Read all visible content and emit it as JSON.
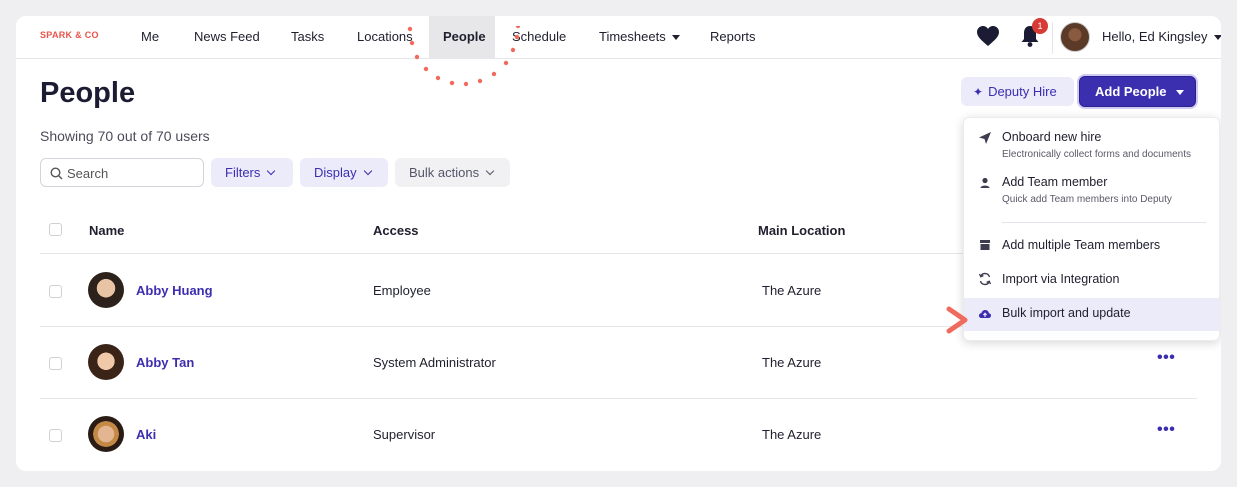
{
  "nav": {
    "brand": "SPARK & CO",
    "items": [
      {
        "label": "Me"
      },
      {
        "label": "News Feed"
      },
      {
        "label": "Tasks"
      },
      {
        "label": "Locations"
      },
      {
        "label": "People"
      },
      {
        "label": "Schedule"
      },
      {
        "label": "Timesheets"
      },
      {
        "label": "Reports"
      }
    ],
    "active": "People",
    "notification_count": "1",
    "greeting": "Hello, Ed Kingsley",
    "icons": [
      "heart-icon",
      "bell-icon",
      "user-avatar"
    ]
  },
  "header": {
    "title": "People",
    "showing": "Showing 70 out of 70 users",
    "deputy_hire_label": "Deputy Hire",
    "add_people_label": "Add People"
  },
  "toolbar": {
    "search_placeholder": "Search",
    "filters_label": "Filters",
    "display_label": "Display",
    "bulk_actions_label": "Bulk actions"
  },
  "table": {
    "columns": [
      "Name",
      "Access",
      "Main Location"
    ],
    "rows": [
      {
        "name": "Abby Huang",
        "access": "Employee",
        "location": "The Azure"
      },
      {
        "name": "Abby Tan",
        "access": "System Administrator",
        "location": "The Azure"
      },
      {
        "name": "Aki",
        "access": "Supervisor",
        "location": "The Azure"
      }
    ],
    "more_label": "•••"
  },
  "menu": {
    "items": [
      {
        "title": "Onboard new hire",
        "subtitle": "Electronically collect forms and documents",
        "icon": "paper-plane-icon"
      },
      {
        "title": "Add Team member",
        "subtitle": "Quick add Team members into Deputy",
        "icon": "person-icon"
      },
      {
        "title": "Add multiple Team members",
        "icon": "store-icon"
      },
      {
        "title": "Import via Integration",
        "icon": "sync-icon"
      },
      {
        "title": "Bulk import and update",
        "icon": "cloud-upload-icon",
        "highlighted": true
      }
    ]
  },
  "colors": {
    "accent": "#3b2fb0",
    "accent_light": "#ecebfa",
    "brand": "#e8534a",
    "annotation": "#f06a5e",
    "badge": "#d83a34"
  }
}
